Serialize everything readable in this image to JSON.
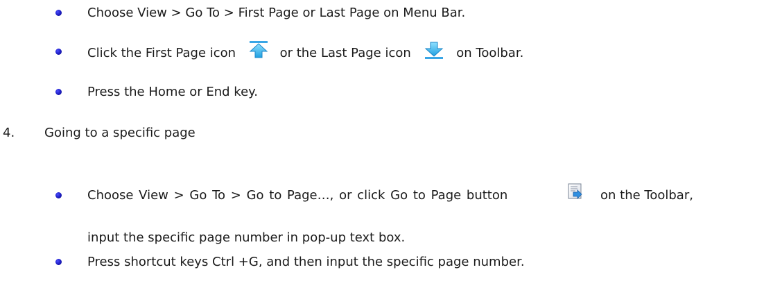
{
  "list_first_last": {
    "items": [
      {
        "text": "Choose View > Go To > First Page or Last Page on Menu Bar."
      },
      {
        "text_a": "Click the First Page icon",
        "icon_a": "first-page-icon",
        "text_b": "or the Last Page icon",
        "icon_b": "last-page-icon",
        "text_c": "on Toolbar."
      },
      {
        "text": "Press the Home or End key."
      }
    ]
  },
  "section_4": {
    "number": "4.",
    "heading": "Going to a specific page"
  },
  "list_specific_page": {
    "items": [
      {
        "text_a": "Choose View > Go To > Go to Page…, or click Go to Page button",
        "icon": "go-to-page-icon",
        "text_b": "on the Toolbar,",
        "continuation": "input the specific page number in pop-up text box."
      },
      {
        "text": "Press shortcut keys Ctrl +G, and then input the specific page number."
      }
    ]
  }
}
